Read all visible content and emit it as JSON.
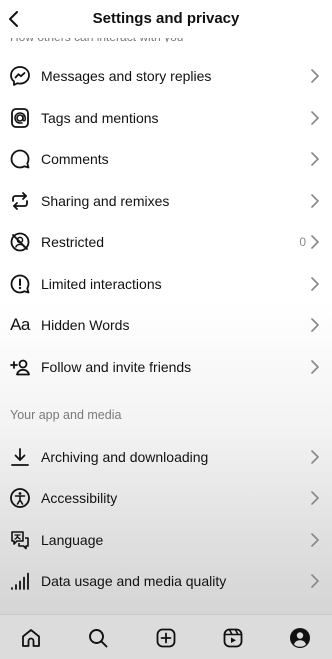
{
  "header": {
    "title": "Settings and privacy"
  },
  "sections": {
    "top_label": "How others can interact with you",
    "app_media_label": "Your app and media"
  },
  "items": [
    {
      "label": "Messages and story replies",
      "icon": "messenger-icon"
    },
    {
      "label": "Tags and mentions",
      "icon": "at-sign-icon"
    },
    {
      "label": "Comments",
      "icon": "comment-icon"
    },
    {
      "label": "Sharing and remixes",
      "icon": "share-remix-icon"
    },
    {
      "label": "Restricted",
      "icon": "restricted-icon",
      "count": "0"
    },
    {
      "label": "Limited interactions",
      "icon": "limited-interactions-icon"
    },
    {
      "label": "Hidden Words",
      "icon": "hidden-words-icon"
    },
    {
      "label": "Follow and invite friends",
      "icon": "add-person-icon"
    }
  ],
  "app_items": [
    {
      "label": "Archiving and downloading",
      "icon": "download-icon"
    },
    {
      "label": "Accessibility",
      "icon": "accessibility-icon"
    },
    {
      "label": "Language",
      "icon": "language-icon"
    },
    {
      "label": "Data usage and media quality",
      "icon": "signal-bars-icon"
    }
  ],
  "bottom_nav": [
    "home-icon",
    "search-icon",
    "create-icon",
    "reels-icon",
    "profile-icon"
  ]
}
